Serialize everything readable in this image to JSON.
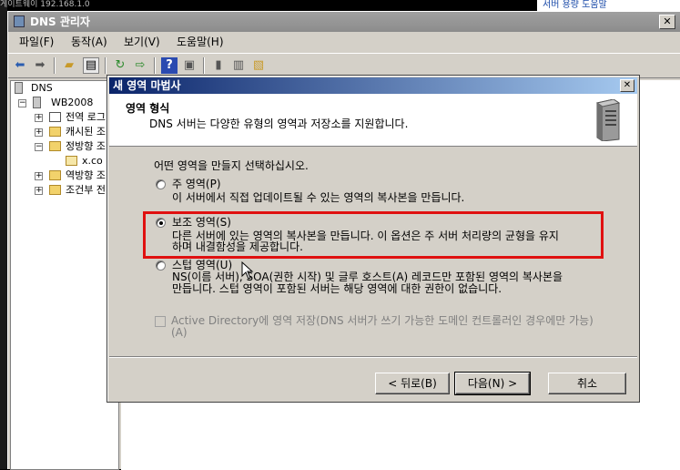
{
  "background": {
    "top_text": "게이트웨이          192.168.1.0",
    "right_text": "서버 용량 도움말"
  },
  "main_window": {
    "title": "DNS 관리자",
    "menu": [
      "파일(F)",
      "동작(A)",
      "보기(V)",
      "도움말(H)"
    ],
    "toolbar_icons": [
      "back-icon",
      "forward-icon",
      "up-folder-icon",
      "show-tree-icon",
      "refresh-icon",
      "export-icon",
      "help-icon",
      "properties-icon",
      "server-icon",
      "list-icon",
      "zone-icon"
    ],
    "tree": [
      {
        "label": "DNS",
        "level": 0
      },
      {
        "label": "WB2008",
        "level": 1,
        "expander": "−"
      },
      {
        "label": "전역 로그",
        "level": 2,
        "expander": "+"
      },
      {
        "label": "캐시된 조",
        "level": 2,
        "expander": "+"
      },
      {
        "label": "정방향 조",
        "level": 2,
        "expander": "−"
      },
      {
        "label": "x.co",
        "level": 3
      },
      {
        "label": "역방향 조",
        "level": 2,
        "expander": "+"
      },
      {
        "label": "조건부 전",
        "level": 2,
        "expander": "+"
      }
    ]
  },
  "wizard": {
    "title": "새 영역 마법사",
    "header_title": "영역 형식",
    "header_subtitle": "DNS 서버는 다양한 유형의 영역과 저장소를 지원합니다.",
    "prompt": "어떤 영역을 만들지 선택하십시오.",
    "options": [
      {
        "label": "주 영역(P)",
        "description": "이 서버에서 직접 업데이트될 수 있는 영역의 복사본을 만듭니다.",
        "checked": false
      },
      {
        "label": "보조 영역(S)",
        "description": "다른 서버에 있는 영역의 복사본을 만듭니다. 이 옵션은 주 서버 처리량의 균형을 유지",
        "description2": "하며 내결함성을 제공합니다.",
        "checked": true
      },
      {
        "label": "스텁 영역(U)",
        "description": "NS(이름 서버), SOA(권한 시작) 및 글루 호스트(A) 레코드만 포함된 영역의 복사본을",
        "description2": "만듭니다. 스텁 영역이 포함된 서버는 해당 영역에 대한 권한이 없습니다.",
        "checked": false
      }
    ],
    "ad_checkbox": {
      "label": "Active Directory에 영역 저장(DNS 서버가 쓰기 가능한 도메인 컨트롤러인 경우에만 가능)",
      "label2": "(A)",
      "checked": false,
      "disabled": true
    },
    "buttons": {
      "back": "< 뒤로(B)",
      "next": "다음(N) >",
      "cancel": "취소"
    },
    "highlight_color": "#e01010"
  }
}
